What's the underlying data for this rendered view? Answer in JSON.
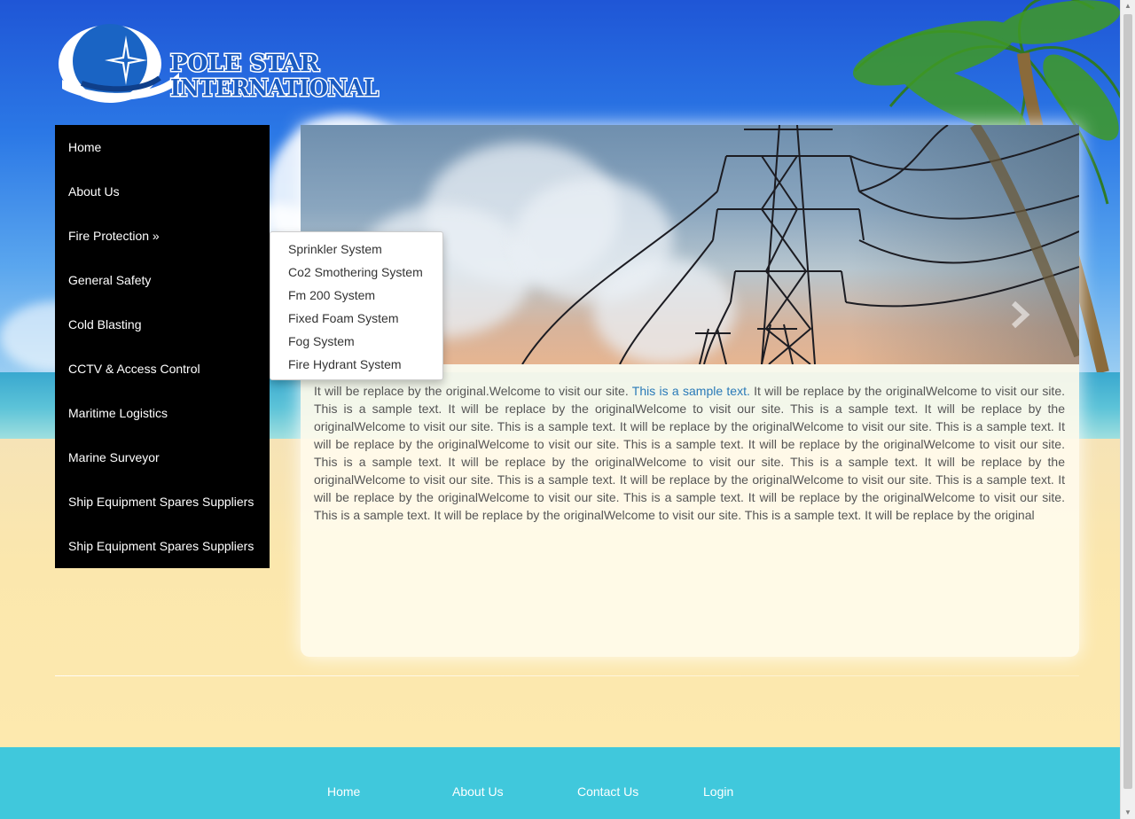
{
  "brand": {
    "logo_text_line1": "POLE STAR",
    "logo_text_line2": "INTERNATIONAL"
  },
  "sidebar": {
    "items": [
      {
        "label": "Home"
      },
      {
        "label": "About Us"
      },
      {
        "label": "Fire Protection »"
      },
      {
        "label": "General Safety"
      },
      {
        "label": "Cold Blasting"
      },
      {
        "label": "CCTV & Access Control"
      },
      {
        "label": "Maritime Logistics"
      },
      {
        "label": "Marine Surveyor"
      },
      {
        "label": "Ship Equipment Spares Suppliers"
      },
      {
        "label": "Ship Equipment Spares Suppliers"
      }
    ]
  },
  "dropdown": {
    "items": [
      {
        "label": "Sprinkler System"
      },
      {
        "label": "Co2 Smothering System"
      },
      {
        "label": "Fm 200 System"
      },
      {
        "label": "Fixed Foam System"
      },
      {
        "label": "Fog System"
      },
      {
        "label": "Fire Hydrant System"
      }
    ]
  },
  "main": {
    "intro": "It will be replace by the original.Welcome to visit our site. ",
    "link_text": "This is a sample text.",
    "body": " It will be replace by the originalWelcome to visit our site. This is a sample text. It will be replace by the originalWelcome to visit our site. This is a sample text. It will be replace by the originalWelcome to visit our site. This is a sample text. It will be replace by the originalWelcome to visit our site. This is a sample text. It will be replace by the originalWelcome to visit our site. This is a sample text. It will be replace by the originalWelcome to visit our site. This is a sample text. It will be replace by the originalWelcome to visit our site. This is a sample text. It will be replace by the originalWelcome to visit our site. This is a sample text. It will be replace by the originalWelcome to visit our site. This is a sample text. It will be replace by the originalWelcome to visit our site. This is a sample text. It will be replace by the originalWelcome to visit our site. This is a sample text. It will be replace by the originalWelcome to visit our site. This is a sample text. It will be replace by the original",
    "slider_next_icon": "chevron-right-icon"
  },
  "footer": {
    "links": [
      {
        "label": "Home"
      },
      {
        "label": "About Us"
      },
      {
        "label": "Contact Us"
      },
      {
        "label": "Login"
      }
    ]
  },
  "colors": {
    "nav_bg": "#000000",
    "footer_bg": "#40c8dc",
    "link": "#2a7ab8",
    "panel_bg": "#fffbec"
  }
}
